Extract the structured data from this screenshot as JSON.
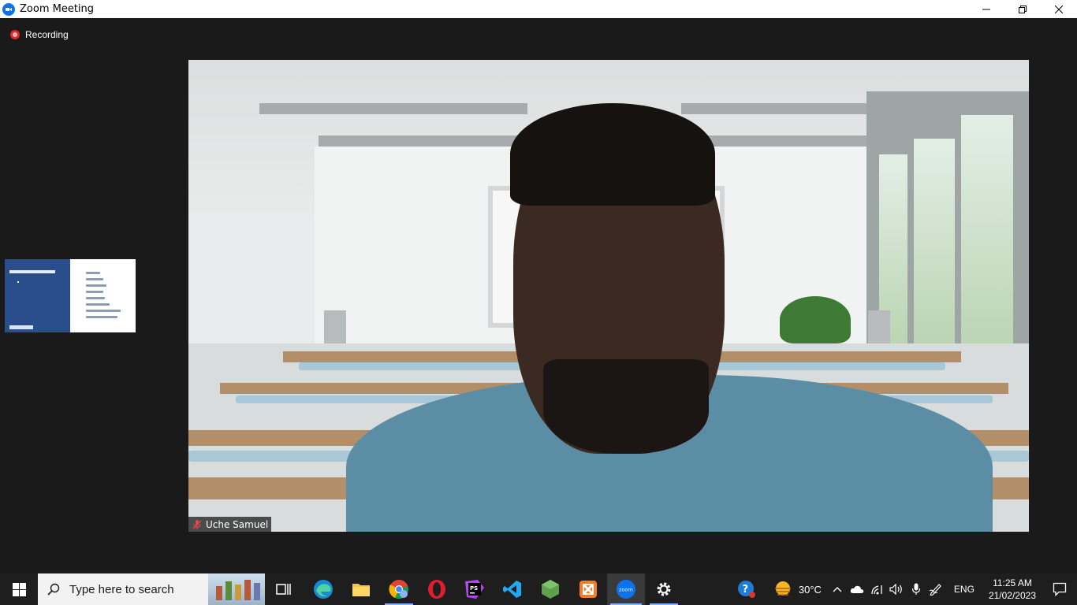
{
  "window": {
    "title": "Zoom Meeting",
    "controls": {
      "minimize": "minimize",
      "restore": "restore",
      "close": "close"
    }
  },
  "meeting": {
    "recording_label": "Recording",
    "participant_name": "Uche Samuel"
  },
  "taskbar": {
    "search_placeholder": "Type here to search",
    "apps": [
      "task-view",
      "edge",
      "file-explorer",
      "chrome",
      "opera",
      "phpstorm",
      "vscode",
      "nodejs",
      "xampp",
      "zoom",
      "settings"
    ],
    "weather_text": "30°C",
    "language": "ENG",
    "time": "11:25 AM",
    "date": "21/02/2023"
  },
  "colors": {
    "zoom_blue": "#0e72ed",
    "recording_red": "#e02828",
    "taskbar_bg": "#1e1e1e",
    "meeting_bg": "#1a1a1a"
  }
}
